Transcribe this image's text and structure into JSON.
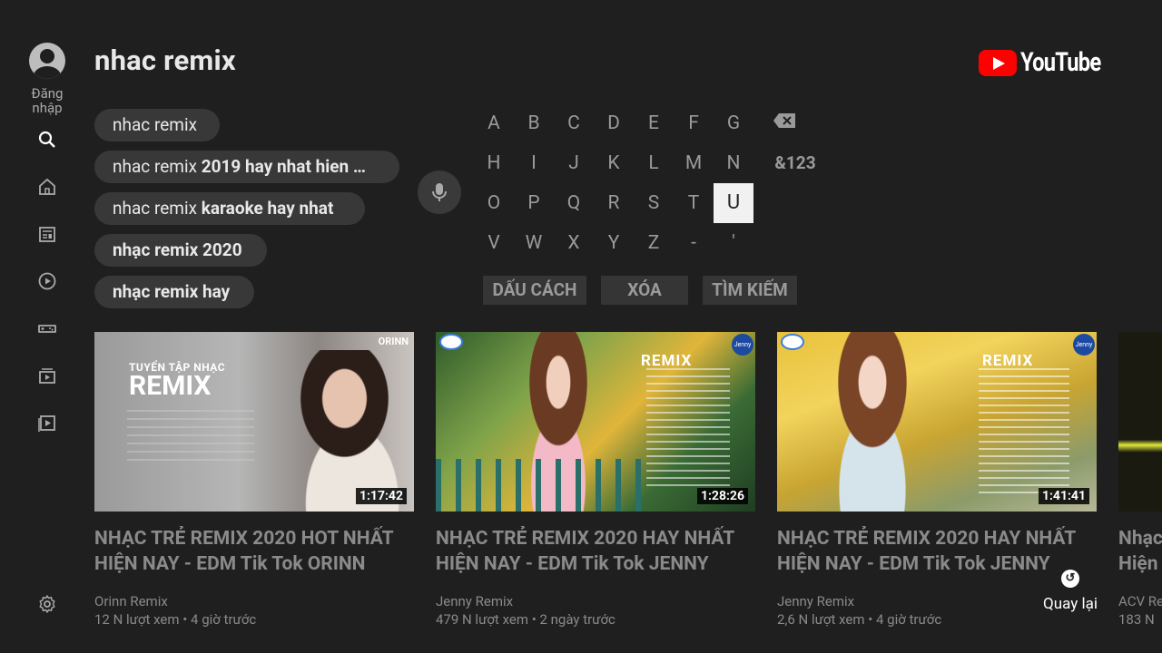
{
  "sidebar": {
    "signin_label": "Đăng nhập",
    "items": [
      "search-icon",
      "home-icon",
      "subscriptions-icon",
      "originals-icon",
      "gaming-icon",
      "queue-icon",
      "library-icon"
    ],
    "settings_icon": "gear-icon"
  },
  "search": {
    "query": "nhac remix"
  },
  "logo": {
    "text": "YouTube",
    "brand_color": "#ff0000"
  },
  "suggestions": [
    {
      "prefix": "nhac remix",
      "suffix": ""
    },
    {
      "prefix": "nhac remix ",
      "suffix": "2019 hay nhat hien …"
    },
    {
      "prefix": "nhac remix ",
      "suffix": "karaoke hay nhat"
    },
    {
      "prefix": "",
      "suffix": "nhạc remix 2020"
    },
    {
      "prefix": "",
      "suffix": "nhạc remix hay"
    }
  ],
  "keyboard": {
    "rows": [
      [
        "A",
        "B",
        "C",
        "D",
        "E",
        "F",
        "G"
      ],
      [
        "H",
        "I",
        "J",
        "K",
        "L",
        "M",
        "N"
      ],
      [
        "O",
        "P",
        "Q",
        "R",
        "S",
        "T",
        "U"
      ],
      [
        "V",
        "W",
        "X",
        "Y",
        "Z",
        "-",
        "'"
      ]
    ],
    "backspace_icon": "backspace-icon",
    "symbols_label": "&123",
    "selected_key": "U",
    "space_label": "DẤU CÁCH",
    "clear_label": "XÓA",
    "search_label": "TÌM KIẾM"
  },
  "videos": [
    {
      "title": "NHẠC TRẺ REMIX 2020 HOT NHẤT HIỆN NAY - EDM Tik Tok ORINN",
      "channel": "Orinn Remix",
      "meta": "12 N lượt xem • 4 giờ trước",
      "duration": "1:17:42",
      "thumb_text": "TUYỂN TẬP NHẠC REMIX",
      "badge": "ORINN"
    },
    {
      "title": "NHẠC TRẺ REMIX 2020 HAY NHẤT HIỆN NAY - EDM Tik Tok JENNY",
      "channel": "Jenny Remix",
      "meta": "479 N lượt xem • 2 ngày trước",
      "duration": "1:28:26",
      "thumb_text": "REMIX",
      "badge": "Jenny"
    },
    {
      "title": "NHẠC TRẺ REMIX 2020 HAY NHẤT HIỆN NAY - EDM Tik Tok JENNY",
      "channel": "Jenny Remix",
      "meta": "2,6 N lượt xem • 4 giờ trước",
      "duration": "1:41:41",
      "thumb_text": "REMIX",
      "badge": "Jenny"
    },
    {
      "title": "Nhạc Hiện",
      "channel": "ACV Re",
      "meta": "183 N",
      "duration": "",
      "thumb_text": "",
      "badge": ""
    }
  ],
  "back": {
    "label": "Quay lại",
    "icon": "back-arrow-icon"
  }
}
